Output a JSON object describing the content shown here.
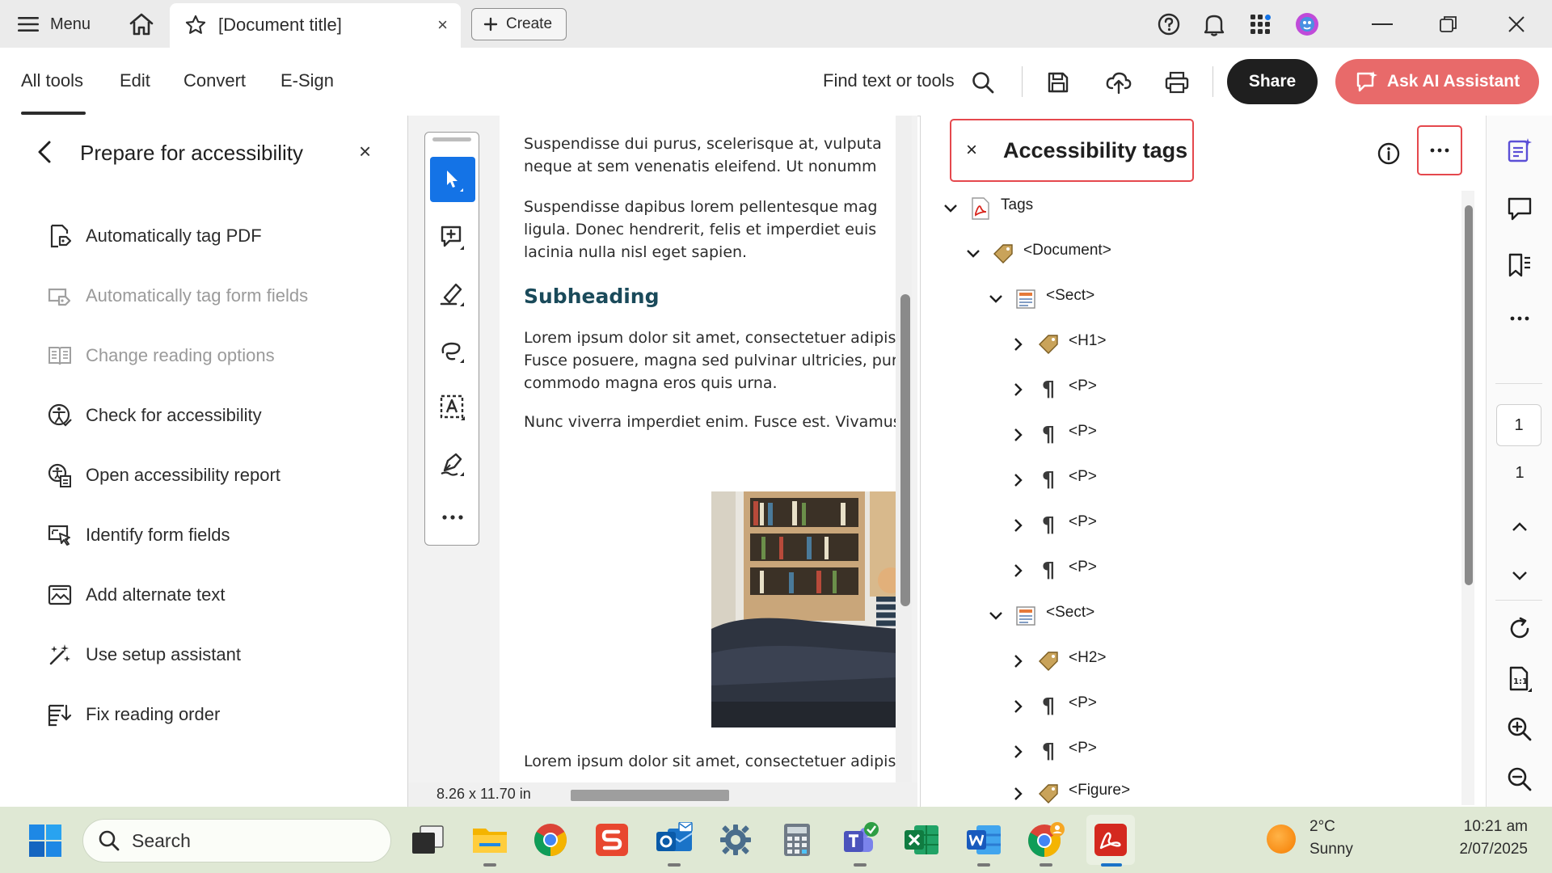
{
  "titlebar": {
    "menu_label": "Menu",
    "tab_title": "[Document title]",
    "tab_close": "×",
    "create_label": "Create"
  },
  "toolbar": {
    "tabs": [
      "All tools",
      "Edit",
      "Convert",
      "E-Sign"
    ],
    "find_label": "Find text or tools",
    "share_label": "Share",
    "ai_label": "Ask AI Assistant"
  },
  "left_panel": {
    "title": "Prepare for accessibility",
    "close": "×",
    "items": [
      {
        "label": "Automatically tag PDF",
        "icon": "tag-pdf-icon",
        "enabled": true
      },
      {
        "label": "Automatically tag form fields",
        "icon": "tag-form-fields-icon",
        "enabled": false
      },
      {
        "label": "Change reading options",
        "icon": "reading-options-icon",
        "enabled": false
      },
      {
        "label": "Check for accessibility",
        "icon": "accessibility-check-icon",
        "enabled": true
      },
      {
        "label": "Open accessibility report",
        "icon": "accessibility-report-icon",
        "enabled": true
      },
      {
        "label": "Identify form fields",
        "icon": "form-fields-icon",
        "enabled": true
      },
      {
        "label": "Add alternate text",
        "icon": "alt-text-icon",
        "enabled": true
      },
      {
        "label": "Use setup assistant",
        "icon": "setup-assistant-icon",
        "enabled": true
      },
      {
        "label": "Fix reading order",
        "icon": "reading-order-icon",
        "enabled": true
      }
    ]
  },
  "document": {
    "lines1": [
      "Suspendisse dui purus, scelerisque at, vulputa",
      "neque at sem venenatis eleifend. Ut nonumm"
    ],
    "lines2": [
      "Suspendisse dapibus lorem pellentesque mag",
      "ligula. Donec hendrerit, felis et imperdiet euis",
      "lacinia nulla nisl eget sapien."
    ],
    "subheading": "Subheading",
    "lines3": [
      "Lorem ipsum dolor sit amet, consectetuer adipis",
      "Fusce posuere, magna sed pulvinar ultricies, pur",
      "commodo magna eros quis urna."
    ],
    "lines4": [
      "Nunc viverra imperdiet enim. Fusce est. Vivamus"
    ],
    "lines5": [
      "Lorem ipsum dolor sit amet, consectetuer adipis"
    ],
    "page_size": "8.26 x 11.70 in"
  },
  "tags_panel": {
    "close": "×",
    "title": "Accessibility tags",
    "tree": [
      {
        "label": "Tags",
        "level": 0,
        "expanded": true,
        "icon": "pdf"
      },
      {
        "label": "<Document>",
        "level": 1,
        "expanded": true,
        "icon": "tag"
      },
      {
        "label": "<Sect>",
        "level": 2,
        "expanded": true,
        "icon": "sect"
      },
      {
        "label": "<H1>",
        "level": 3,
        "expanded": false,
        "icon": "tag"
      },
      {
        "label": "<P>",
        "level": 3,
        "expanded": false,
        "icon": "para"
      },
      {
        "label": "<P>",
        "level": 3,
        "expanded": false,
        "icon": "para"
      },
      {
        "label": "<P>",
        "level": 3,
        "expanded": false,
        "icon": "para"
      },
      {
        "label": "<P>",
        "level": 3,
        "expanded": false,
        "icon": "para"
      },
      {
        "label": "<P>",
        "level": 3,
        "expanded": false,
        "icon": "para"
      },
      {
        "label": "<Sect>",
        "level": 2,
        "expanded": true,
        "icon": "sect"
      },
      {
        "label": "<H2>",
        "level": 3,
        "expanded": false,
        "icon": "tag"
      },
      {
        "label": "<P>",
        "level": 3,
        "expanded": false,
        "icon": "para"
      },
      {
        "label": "<P>",
        "level": 3,
        "expanded": false,
        "icon": "para"
      },
      {
        "label": "<Figure>",
        "level": 3,
        "expanded": false,
        "icon": "tag"
      }
    ]
  },
  "right_rail": {
    "current_page": "1",
    "total_pages": "1"
  },
  "taskbar": {
    "search_label": "Search",
    "weather_temp": "2°C",
    "weather_desc": "Sunny",
    "time": "10:21 am",
    "date": "2/07/2025"
  },
  "colors": {
    "accent_blue": "#1473e6",
    "ai_button": "#e86a6a",
    "highlight_red": "#e5484d",
    "share_button": "#1f1f1f",
    "taskbar": "#dfe8d4"
  }
}
